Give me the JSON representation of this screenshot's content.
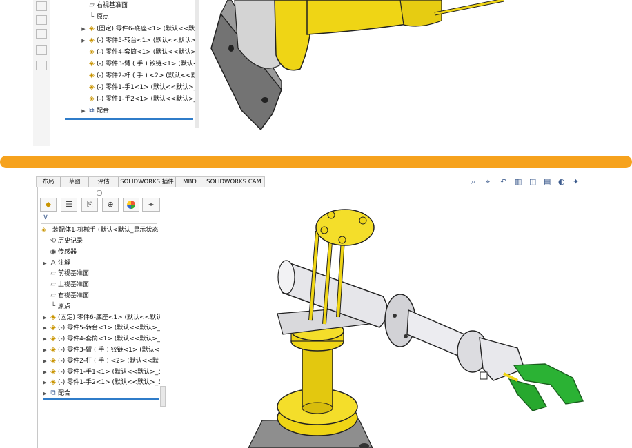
{
  "top_tree": {
    "items": [
      {
        "label": "右视基准面",
        "icon": "plane-icon",
        "arrow": ""
      },
      {
        "label": "原点",
        "icon": "origin-icon",
        "arrow": ""
      },
      {
        "label": "(固定) 零件6-底座<1> (默认<<默认",
        "icon": "part-icon",
        "arrow": "▶"
      },
      {
        "label": "(-) 零件5-转台<1> (默认<<默认>_",
        "icon": "part-icon",
        "arrow": "▶"
      },
      {
        "label": "(-) 零件4-套筒<1> (默认<<默认>_",
        "icon": "part-icon",
        "arrow": ""
      },
      {
        "label": "(-) 零件3-臂 ( 手 ) 铰链<1> (默认<",
        "icon": "part-icon",
        "arrow": ""
      },
      {
        "label": "(-) 零件2-杆 ( 手 ) <2> (默认<<默",
        "icon": "part-icon",
        "arrow": ""
      },
      {
        "label": "(-) 零件1-手1<1> (默认<<默认>_5",
        "icon": "part-icon",
        "arrow": ""
      },
      {
        "label": "(-) 零件1-手2<1> (默认<<默认>_5",
        "icon": "part-icon",
        "arrow": ""
      },
      {
        "label": "配合",
        "icon": "mate-icon",
        "arrow": "▶"
      }
    ]
  },
  "command_tabs": [
    {
      "label": "布局"
    },
    {
      "label": "草图"
    },
    {
      "label": "评估"
    },
    {
      "label": "SOLIDWORKS 插件"
    },
    {
      "label": "MBD"
    },
    {
      "label": "SOLIDWORKS CAM"
    }
  ],
  "panel_icons": [
    "featuremanager-icon",
    "propertymanager-icon",
    "configurationmanager-icon",
    "dimxpert-icon",
    "display-manager-icon"
  ],
  "tree": {
    "root": "装配体1-机械手 (默认<默认_显示状态-",
    "items": [
      {
        "label": "历史记录",
        "icon": "history-icon",
        "arrow": ""
      },
      {
        "label": "传感器",
        "icon": "sensor-icon",
        "arrow": ""
      },
      {
        "label": "注解",
        "icon": "annotation-icon",
        "arrow": "▶"
      },
      {
        "label": "前视基准面",
        "icon": "plane-icon",
        "arrow": ""
      },
      {
        "label": "上视基准面",
        "icon": "plane-icon",
        "arrow": ""
      },
      {
        "label": "右视基准面",
        "icon": "plane-icon",
        "arrow": ""
      },
      {
        "label": "原点",
        "icon": "origin-icon",
        "arrow": ""
      },
      {
        "label": "(固定) 零件6-底座<1> (默认<<默认",
        "icon": "part-icon",
        "arrow": "▶"
      },
      {
        "label": "(-) 零件5-转台<1> (默认<<默认>_",
        "icon": "part-icon",
        "arrow": "▶"
      },
      {
        "label": "(-) 零件4-套筒<1> (默认<<默认>_",
        "icon": "part-icon",
        "arrow": "▶"
      },
      {
        "label": "(-) 零件3-臂 ( 手 ) 铰链<1> (默认<",
        "icon": "part-icon",
        "arrow": "▶"
      },
      {
        "label": "(-) 零件2-杆 ( 手 ) <2> (默认<<默",
        "icon": "part-icon",
        "arrow": "▶"
      },
      {
        "label": "(-) 零件1-手1<1> (默认<<默认>_5",
        "icon": "part-icon",
        "arrow": "▶"
      },
      {
        "label": "(-) 零件1-手2<1> (默认<<默认>_5",
        "icon": "part-icon",
        "arrow": "▶"
      },
      {
        "label": "配合",
        "icon": "mate-icon",
        "arrow": "▶"
      }
    ]
  },
  "heads_up_toolbar": [
    "zoom-to-fit-icon",
    "zoom-to-area-icon",
    "previous-view-icon",
    "section-view-icon",
    "view-orientation-icon",
    "display-style-icon",
    "hide-show-icon",
    "edit-appearance-icon"
  ],
  "colors": {
    "divider": "#f6a21d",
    "model_yellow": "#f2d90f",
    "model_gray": "#c8c8cc",
    "gripper_green": "#27a82e",
    "selection_blue": "#2f7cc9"
  }
}
